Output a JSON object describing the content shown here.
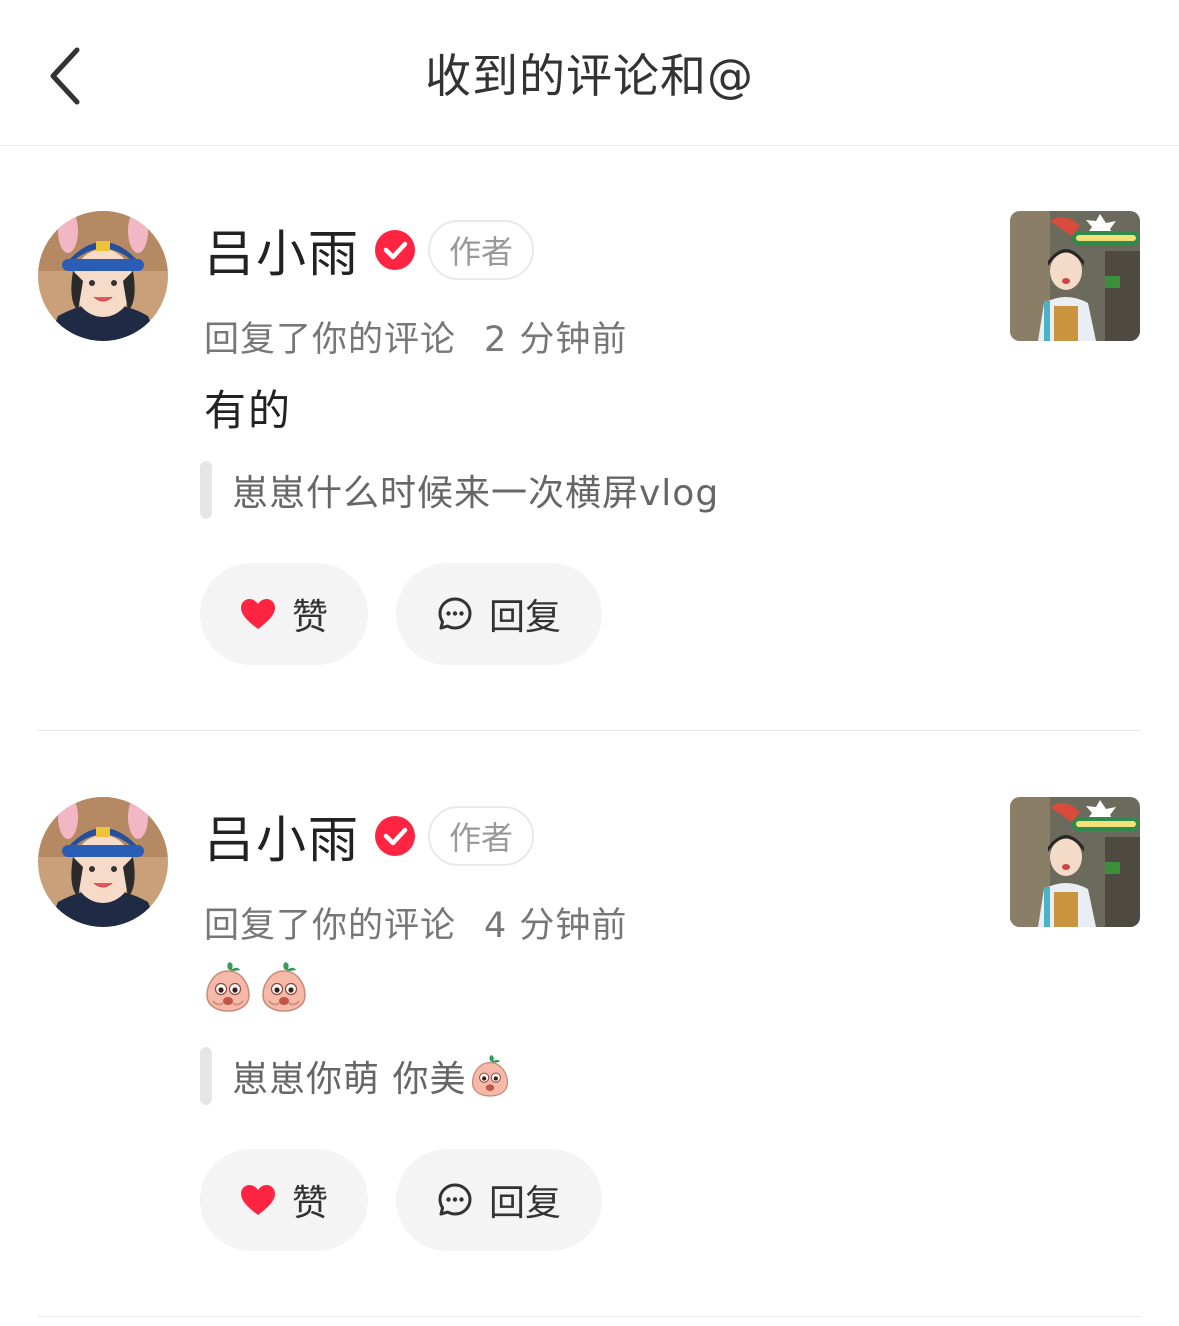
{
  "header": {
    "title": "收到的评论和@"
  },
  "notifications": [
    {
      "username": "吕小雨",
      "author_tag": "作者",
      "action": "回复了你的评论",
      "time": "2 分钟前",
      "content": "有的",
      "quote": "崽崽什么时候来一次横屏vlog",
      "like_label": "赞",
      "reply_label": "回复"
    },
    {
      "username": "吕小雨",
      "author_tag": "作者",
      "action": "回复了你的评论",
      "time": "4 分钟前",
      "content_emojis": [
        "peach-emoji",
        "peach-emoji"
      ],
      "quote": "崽崽你萌 你美",
      "quote_emoji": "peach-emoji",
      "like_label": "赞",
      "reply_label": "回复"
    }
  ],
  "colors": {
    "accent_red": "#ff2442",
    "verified_red": "#ff2442",
    "button_bg": "#f4f4f4"
  }
}
